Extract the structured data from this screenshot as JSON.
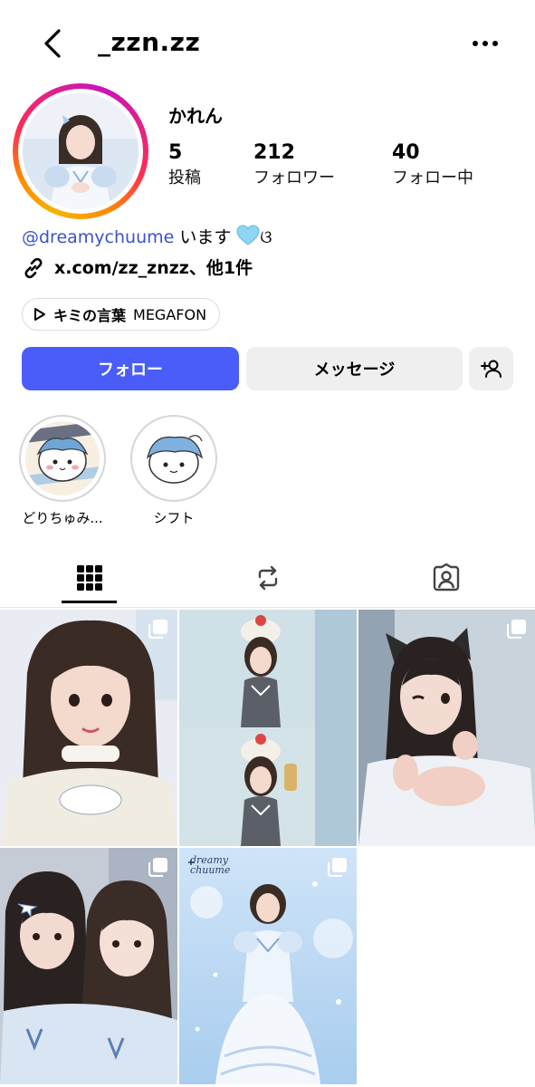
{
  "header": {
    "username": "_zzn.zz",
    "back_icon": "chevron-left-icon",
    "more_icon": "ellipsis-icon"
  },
  "profile": {
    "display_name": "かれん",
    "stats": {
      "posts": {
        "count": "5",
        "label": "投稿"
      },
      "followers": {
        "count": "212",
        "label": "フォロワー"
      },
      "following": {
        "count": "40",
        "label": "フォロー中"
      }
    },
    "bio": {
      "mention": "@dreamychuume",
      "text": " います",
      "emoji_tail": "ଓ"
    },
    "link": {
      "text": "x.com/zz_znzz、他1件",
      "icon": "link-icon"
    },
    "music": {
      "song": "キミの言葉",
      "artist": "MEGAFON",
      "icon": "play-icon"
    }
  },
  "actions": {
    "follow_label": "フォロー",
    "message_label": "メッセージ",
    "add_user_icon": "add-user-icon"
  },
  "highlights": [
    {
      "label": "どりちゅみ..."
    },
    {
      "label": "シフト"
    }
  ],
  "tabs": [
    {
      "name": "grid",
      "icon": "grid-icon",
      "active": true
    },
    {
      "name": "reposts",
      "icon": "repost-icon",
      "active": false
    },
    {
      "name": "tagged",
      "icon": "tagged-user-icon",
      "active": false
    }
  ],
  "posts": [
    {
      "multi": true
    },
    {
      "multi": false
    },
    {
      "multi": true
    },
    {
      "multi": true
    },
    {
      "multi": true,
      "watermark": "dreamy chuume"
    }
  ],
  "colors": {
    "follow_button": "#4a5df9",
    "mention": "#3b53c9",
    "secondary_button": "#efefef"
  }
}
